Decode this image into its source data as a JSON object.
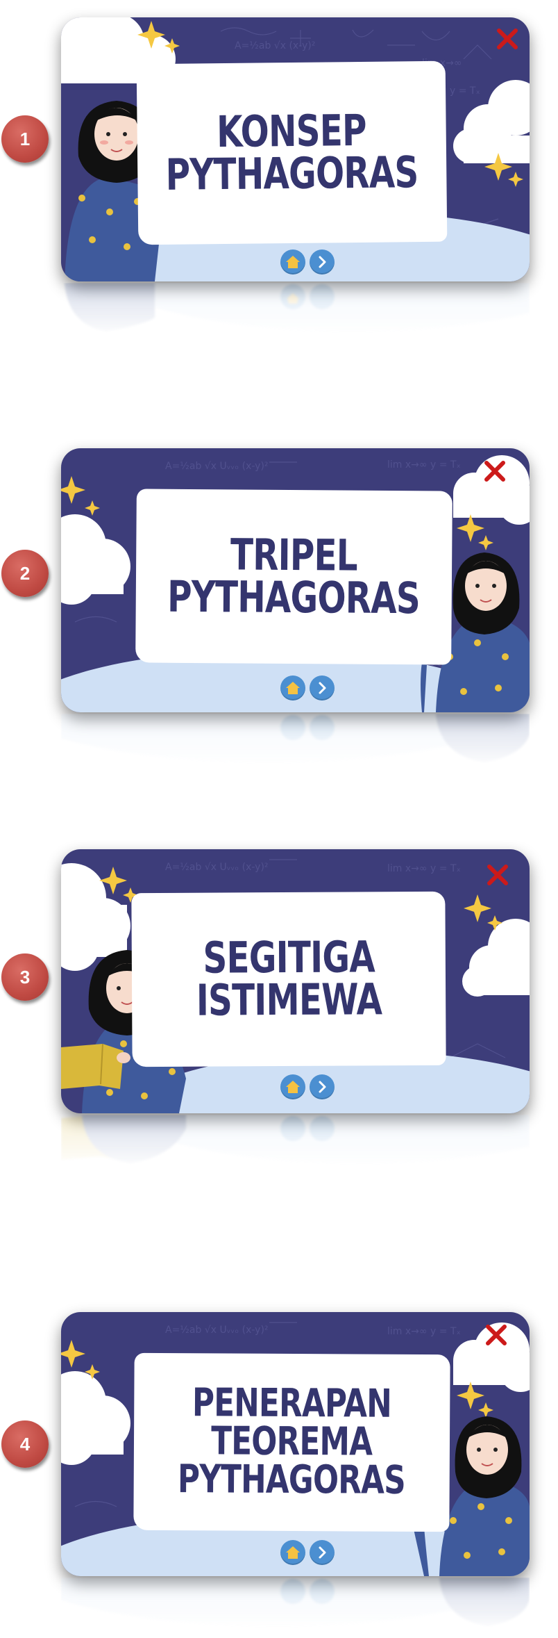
{
  "colors": {
    "slide_bg": "#3d3d7a",
    "board": "#ffffff",
    "title_text": "#34356e",
    "close_x": "#cc1a1a",
    "nav_button": "#4b8fd1",
    "home_icon": "#f5c242",
    "badge": "#c04a43",
    "sparkle": "#f5c842",
    "hill": "#cfe0f5"
  },
  "slides": [
    {
      "number": "1",
      "title_lines": [
        "KONSEP",
        "PYTHAGORAS"
      ]
    },
    {
      "number": "2",
      "title_lines": [
        "TRIPEL",
        "PYTHAGORAS"
      ]
    },
    {
      "number": "3",
      "title_lines": [
        "SEGITIGA",
        "ISTIMEWA"
      ]
    },
    {
      "number": "4",
      "title_lines": [
        "PENERAPAN",
        "TEOREMA",
        "PYTHAGORAS"
      ]
    }
  ],
  "icons": {
    "close": "close-x-icon",
    "home": "home-icon",
    "next": "chevron-right-icon",
    "teacher": "teacher-illustration"
  }
}
